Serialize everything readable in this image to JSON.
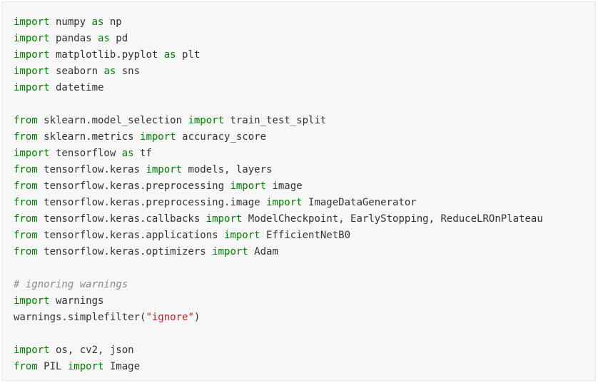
{
  "colors": {
    "background": "#f7f7f7",
    "border": "#e6e6e6",
    "keyword": "#008000",
    "text": "#333333",
    "string": "#ba2121",
    "comment": "#8a8a8a"
  },
  "code": {
    "lines": [
      [
        {
          "t": "kw",
          "v": "import"
        },
        {
          "t": "name",
          "v": " numpy "
        },
        {
          "t": "kw",
          "v": "as"
        },
        {
          "t": "name",
          "v": " np"
        }
      ],
      [
        {
          "t": "kw",
          "v": "import"
        },
        {
          "t": "name",
          "v": " pandas "
        },
        {
          "t": "kw",
          "v": "as"
        },
        {
          "t": "name",
          "v": " pd"
        }
      ],
      [
        {
          "t": "kw",
          "v": "import"
        },
        {
          "t": "name",
          "v": " matplotlib.pyplot "
        },
        {
          "t": "kw",
          "v": "as"
        },
        {
          "t": "name",
          "v": " plt"
        }
      ],
      [
        {
          "t": "kw",
          "v": "import"
        },
        {
          "t": "name",
          "v": " seaborn "
        },
        {
          "t": "kw",
          "v": "as"
        },
        {
          "t": "name",
          "v": " sns"
        }
      ],
      [
        {
          "t": "kw",
          "v": "import"
        },
        {
          "t": "name",
          "v": " datetime"
        }
      ],
      [],
      [
        {
          "t": "kw",
          "v": "from"
        },
        {
          "t": "name",
          "v": " sklearn.model_selection "
        },
        {
          "t": "kw",
          "v": "import"
        },
        {
          "t": "name",
          "v": " train_test_split"
        }
      ],
      [
        {
          "t": "kw",
          "v": "from"
        },
        {
          "t": "name",
          "v": " sklearn.metrics "
        },
        {
          "t": "kw",
          "v": "import"
        },
        {
          "t": "name",
          "v": " accuracy_score"
        }
      ],
      [
        {
          "t": "kw",
          "v": "import"
        },
        {
          "t": "name",
          "v": " tensorflow "
        },
        {
          "t": "kw",
          "v": "as"
        },
        {
          "t": "name",
          "v": " tf"
        }
      ],
      [
        {
          "t": "kw",
          "v": "from"
        },
        {
          "t": "name",
          "v": " tensorflow.keras "
        },
        {
          "t": "kw",
          "v": "import"
        },
        {
          "t": "name",
          "v": " models, layers"
        }
      ],
      [
        {
          "t": "kw",
          "v": "from"
        },
        {
          "t": "name",
          "v": " tensorflow.keras.preprocessing "
        },
        {
          "t": "kw",
          "v": "import"
        },
        {
          "t": "name",
          "v": " image"
        }
      ],
      [
        {
          "t": "kw",
          "v": "from"
        },
        {
          "t": "name",
          "v": " tensorflow.keras.preprocessing.image "
        },
        {
          "t": "kw",
          "v": "import"
        },
        {
          "t": "name",
          "v": " ImageDataGenerator"
        }
      ],
      [
        {
          "t": "kw",
          "v": "from"
        },
        {
          "t": "name",
          "v": " tensorflow.keras.callbacks "
        },
        {
          "t": "kw",
          "v": "import"
        },
        {
          "t": "name",
          "v": " ModelCheckpoint, EarlyStopping, ReduceLROnPlateau"
        }
      ],
      [
        {
          "t": "kw",
          "v": "from"
        },
        {
          "t": "name",
          "v": " tensorflow.keras.applications "
        },
        {
          "t": "kw",
          "v": "import"
        },
        {
          "t": "name",
          "v": " EfficientNetB0"
        }
      ],
      [
        {
          "t": "kw",
          "v": "from"
        },
        {
          "t": "name",
          "v": " tensorflow.keras.optimizers "
        },
        {
          "t": "kw",
          "v": "import"
        },
        {
          "t": "name",
          "v": " Adam"
        }
      ],
      [],
      [
        {
          "t": "comment",
          "v": "# ignoring warnings"
        }
      ],
      [
        {
          "t": "kw",
          "v": "import"
        },
        {
          "t": "name",
          "v": " warnings"
        }
      ],
      [
        {
          "t": "name",
          "v": "warnings.simplefilter("
        },
        {
          "t": "str",
          "v": "\"ignore\""
        },
        {
          "t": "name",
          "v": ")"
        }
      ],
      [],
      [
        {
          "t": "kw",
          "v": "import"
        },
        {
          "t": "name",
          "v": " os, cv2, json"
        }
      ],
      [
        {
          "t": "kw",
          "v": "from"
        },
        {
          "t": "name",
          "v": " PIL "
        },
        {
          "t": "kw",
          "v": "import"
        },
        {
          "t": "name",
          "v": " Image"
        }
      ]
    ]
  }
}
